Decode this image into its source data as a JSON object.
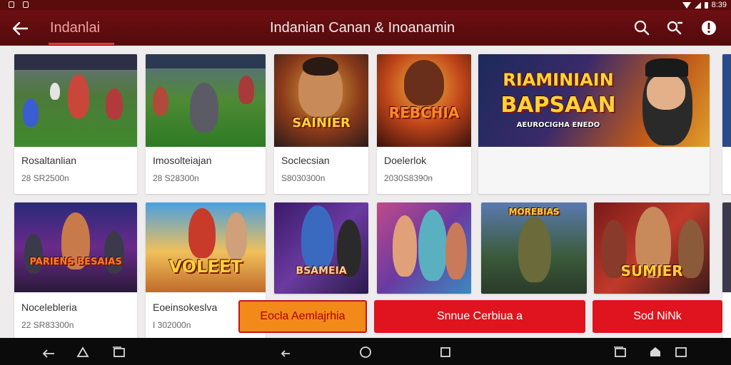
{
  "appbar": {
    "active_tab": "Indanlai",
    "title": "Indanian Canan & Inoanamin"
  },
  "icons": [
    "back-arrow-icon",
    "search-icon",
    "search-alt-icon",
    "info-icon",
    "home-icon",
    "back-icon",
    "recents-icon",
    "circle-home-icon"
  ],
  "status": {
    "time": "8:39"
  },
  "row1": [
    {
      "title": "Rosaltanlian",
      "sub": "28 SR2500n",
      "art": ""
    },
    {
      "title": "Imosolteiajan",
      "sub": "28 S28300n",
      "art": ""
    },
    {
      "title": "Soclecsian",
      "sub": "S8030300n",
      "art": "SAINIER"
    },
    {
      "title": "Doelerlok",
      "sub": "2030S8390n",
      "art": "REBCHIA"
    }
  ],
  "banner": {
    "line1": "RIAMINIAIN",
    "line2": "BAPSAAN",
    "line3": "AEUROCIGHA ENEDO"
  },
  "row2": [
    {
      "title": "Nocelebleria",
      "sub": "22 SR83300n",
      "art": "PARIENS BESAIAS"
    },
    {
      "title": "Eoeinsokeslva",
      "sub": "I 302000n",
      "art": "VOLEET"
    },
    {
      "art": "BSAMEIA"
    },
    {
      "art": ""
    },
    {
      "art": "MOREBIAS"
    },
    {
      "art": "SUMIER"
    }
  ],
  "buttons": [
    {
      "label": "Eocla Aemlajrhia"
    },
    {
      "label": "Snnue Cerbiua a"
    },
    {
      "label": "Sod NiNk"
    }
  ],
  "colors": {
    "appbar": "#5e0c0e",
    "accent": "#e0141e",
    "button_orange": "#f28a1a"
  }
}
